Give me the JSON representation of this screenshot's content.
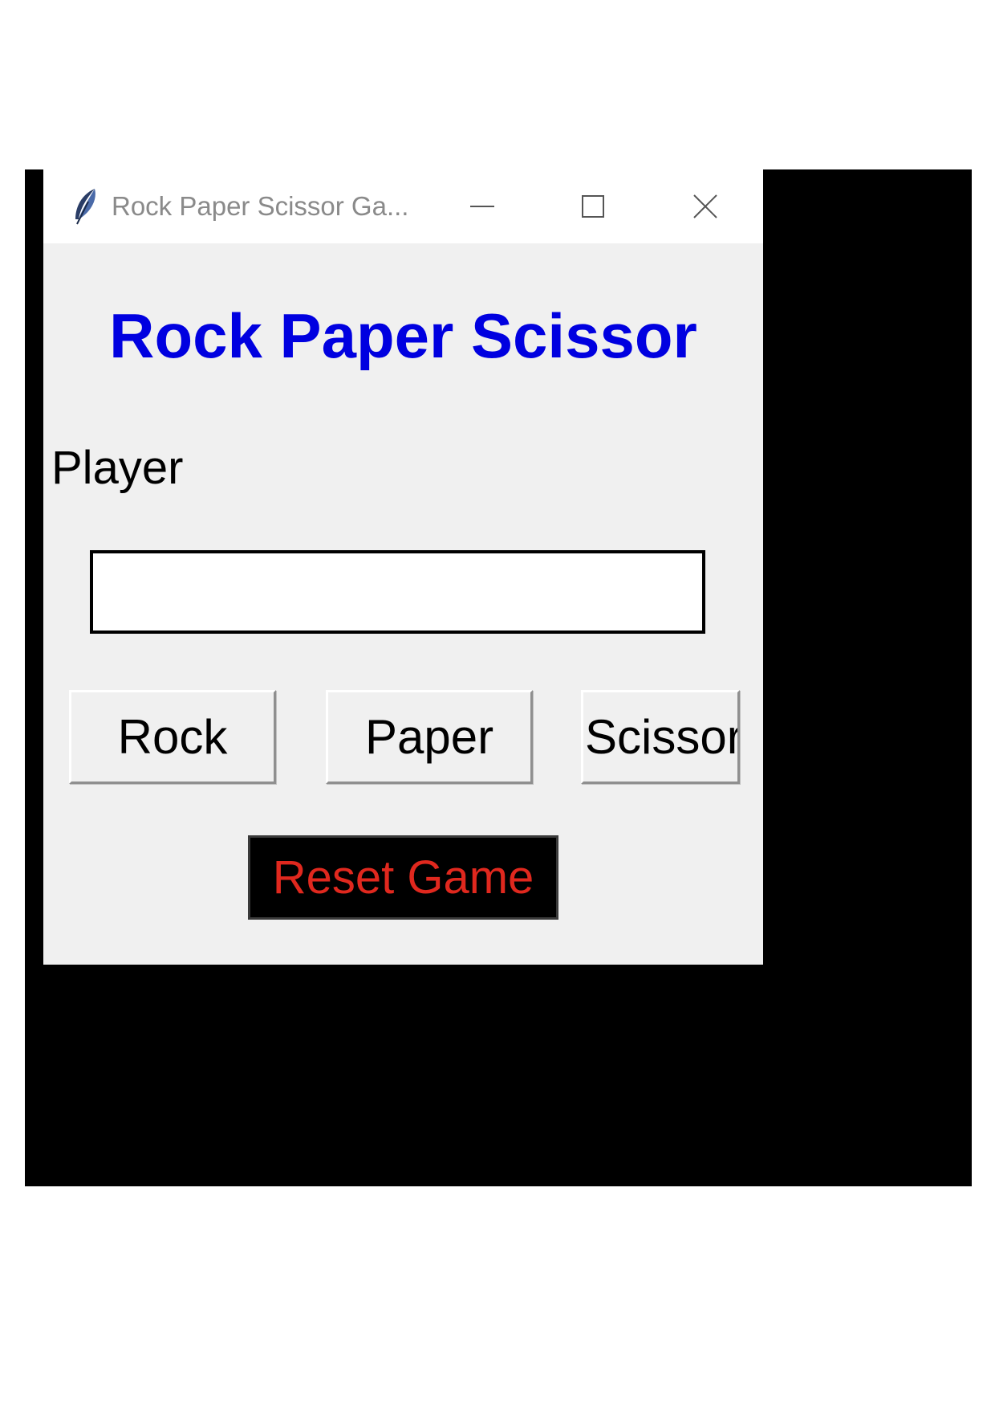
{
  "window": {
    "title": "Rock Paper Scissor Ga...",
    "icon": "feather-icon"
  },
  "app": {
    "title": "Rock Paper Scissor",
    "title_color": "#0000e0",
    "player_label": "Player",
    "player_input_value": "",
    "buttons": {
      "rock": "Rock",
      "paper": "Paper",
      "scissor": "Scissor"
    },
    "reset": {
      "label": "Reset Game",
      "text_color": "#e0281e",
      "background": "#000000"
    }
  }
}
